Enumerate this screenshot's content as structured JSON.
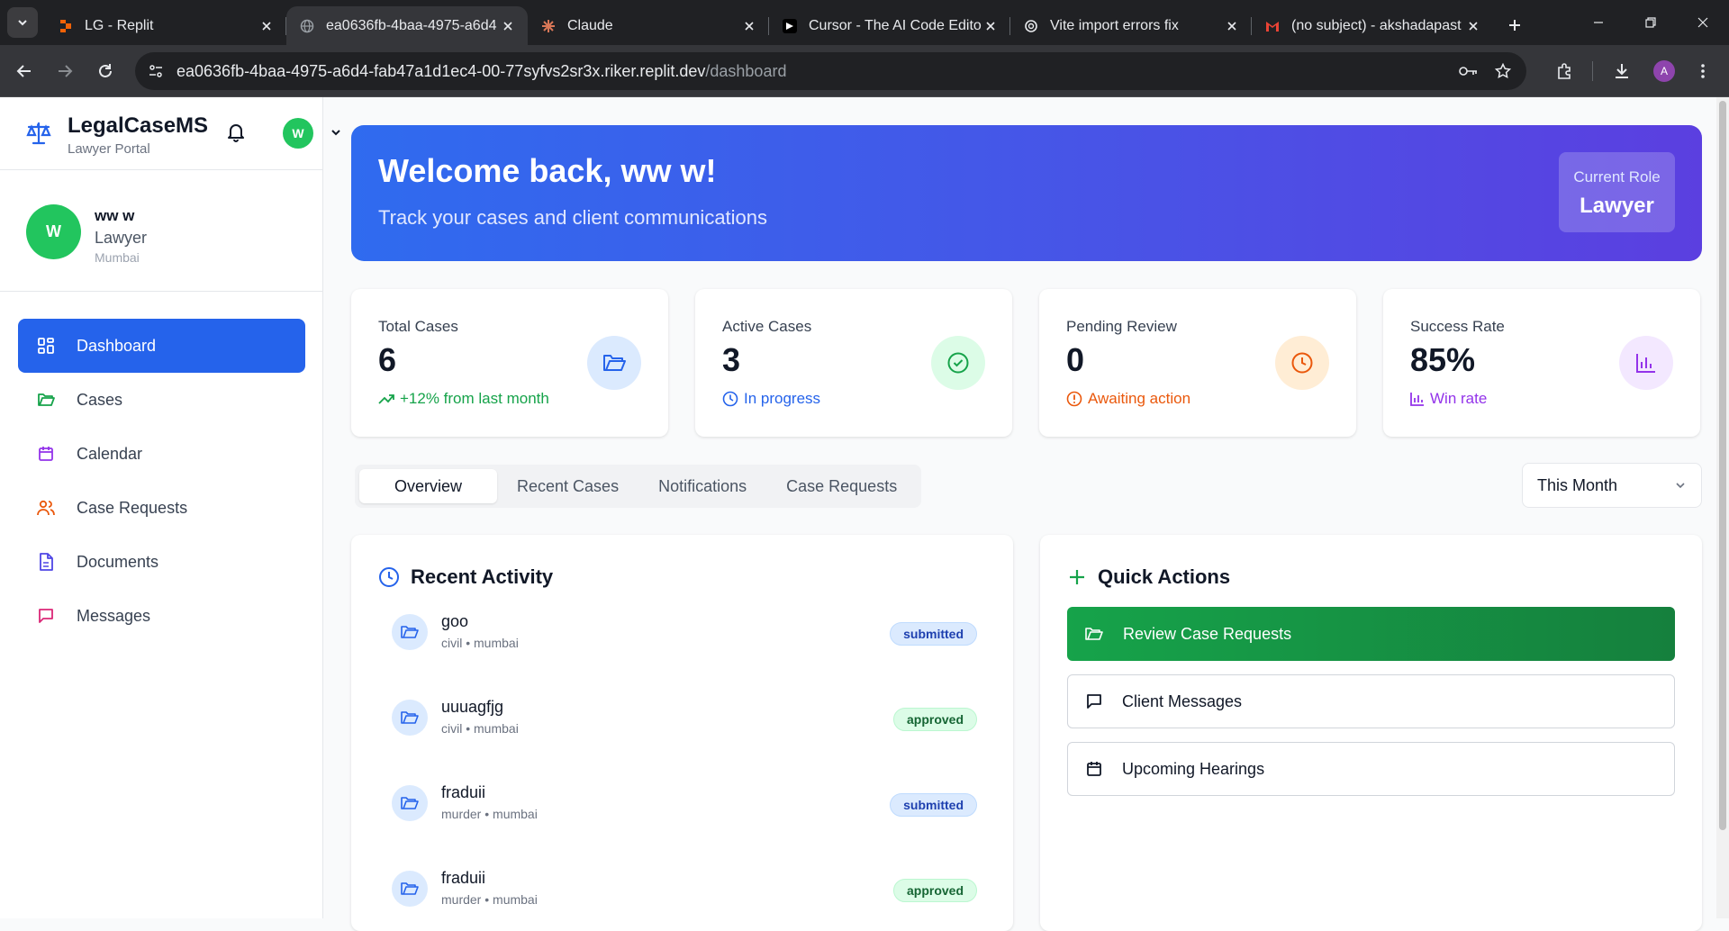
{
  "browser": {
    "tabs": [
      {
        "title": "LG - Replit",
        "icon": "replit-icon"
      },
      {
        "title": "ea0636fb-4baa-4975-a6d4",
        "icon": "globe-icon",
        "active": true
      },
      {
        "title": "Claude",
        "icon": "claude-icon"
      },
      {
        "title": "Cursor - The AI Code Edito",
        "icon": "cursor-icon"
      },
      {
        "title": "Vite import errors fix",
        "icon": "chatgpt-icon"
      },
      {
        "title": "(no subject) - akshadapast",
        "icon": "gmail-icon"
      }
    ],
    "url_host": "ea0636fb-4baa-4975-a6d4-fab47a1d1ec4-00-77syfvs2sr3x.riker.replit.dev",
    "url_path": "/dashboard",
    "profile_initial": "A"
  },
  "brand": {
    "name": "LegalCaseMS",
    "subtitle": "Lawyer Portal",
    "avatar_initial": "W"
  },
  "profile": {
    "initial": "W",
    "name": "ww w",
    "role": "Lawyer",
    "city": "Mumbai"
  },
  "nav": [
    {
      "label": "Dashboard",
      "icon": "grid-icon",
      "active": true
    },
    {
      "label": "Cases",
      "icon": "folder-icon"
    },
    {
      "label": "Calendar",
      "icon": "calendar-icon"
    },
    {
      "label": "Case Requests",
      "icon": "users-icon"
    },
    {
      "label": "Documents",
      "icon": "document-icon"
    },
    {
      "label": "Messages",
      "icon": "message-icon"
    }
  ],
  "hero": {
    "title": "Welcome back, ww w!",
    "subtitle": "Track your cases and client communications",
    "role_label": "Current Role",
    "role_value": "Lawyer"
  },
  "stats": [
    {
      "label": "Total Cases",
      "value": "6",
      "note": "+12% from last month",
      "note_color": "#16a34a",
      "icon": "folder-open-icon",
      "icon_color": "#2563eb",
      "icon_bg": "#dbeafe"
    },
    {
      "label": "Active Cases",
      "value": "3",
      "note": "In progress",
      "note_color": "#2563eb",
      "icon": "check-circle-icon",
      "icon_color": "#16a34a",
      "icon_bg": "#dcfce7"
    },
    {
      "label": "Pending Review",
      "value": "0",
      "note": "Awaiting action",
      "note_color": "#ea580c",
      "icon": "clock-icon",
      "icon_color": "#ea580c",
      "icon_bg": "#ffedd5"
    },
    {
      "label": "Success Rate",
      "value": "85%",
      "note": "Win rate",
      "note_color": "#9333ea",
      "icon": "bar-chart-icon",
      "icon_color": "#9333ea",
      "icon_bg": "#f3e8ff"
    }
  ],
  "tabs": [
    "Overview",
    "Recent Cases",
    "Notifications",
    "Case Requests"
  ],
  "period": {
    "selected": "This Month"
  },
  "recent_activity": {
    "title": "Recent Activity",
    "items": [
      {
        "name": "goo",
        "meta": "civil • mumbai",
        "status": "submitted"
      },
      {
        "name": "uuuagfjg",
        "meta": "civil • mumbai",
        "status": "approved"
      },
      {
        "name": "fraduii",
        "meta": "murder • mumbai",
        "status": "submitted"
      },
      {
        "name": "fraduii",
        "meta": "murder • mumbai",
        "status": "approved"
      }
    ]
  },
  "quick_actions": {
    "title": "Quick Actions",
    "items": [
      {
        "label": "Review Case Requests",
        "icon": "folder-open-icon",
        "style": "primary"
      },
      {
        "label": "Client Messages",
        "icon": "message-icon",
        "style": "outline"
      },
      {
        "label": "Upcoming Hearings",
        "icon": "calendar-icon",
        "style": "outline"
      }
    ]
  },
  "colors": {
    "accent": "#2563eb",
    "success": "#16a34a"
  }
}
